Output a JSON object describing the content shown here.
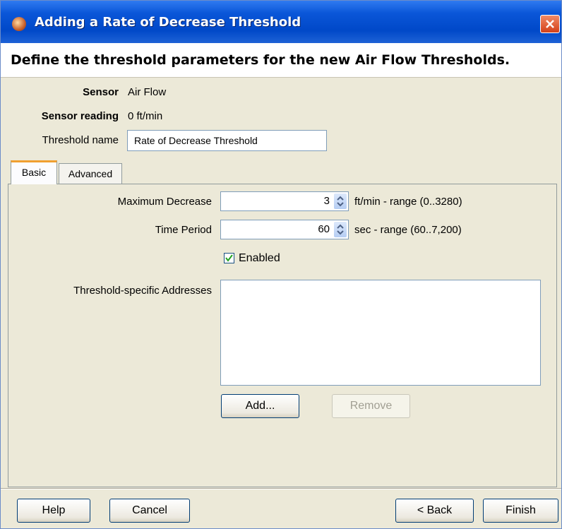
{
  "window": {
    "title": "Adding a Rate of Decrease Threshold",
    "title_color": "#0a56d8",
    "close_color": "#d44018"
  },
  "header": {
    "text": "Define the threshold parameters for the new Air Flow Thresholds."
  },
  "info": {
    "sensor_label": "Sensor",
    "sensor_value": "Air Flow",
    "reading_label": "Sensor reading",
    "reading_value": "0 ft/min",
    "name_label": "Threshold name",
    "name_value": "Rate of Decrease Threshold"
  },
  "tabs": [
    {
      "label": "Basic",
      "active": true
    },
    {
      "label": "Advanced",
      "active": false
    }
  ],
  "basic": {
    "max_decrease_label": "Maximum Decrease",
    "max_decrease_value": "3",
    "max_decrease_unit": "ft/min - range (0..3280)",
    "time_period_label": "Time Period",
    "time_period_value": "60",
    "time_period_unit": "sec - range (60..7,200)",
    "enabled_label": "Enabled",
    "enabled_checked": true,
    "addresses_label": "Threshold-specific Addresses",
    "addresses": [],
    "add_label": "Add...",
    "remove_label": "Remove"
  },
  "footer": {
    "help_label": "Help",
    "cancel_label": "Cancel",
    "back_label": "< Back",
    "finish_label": "Finish"
  }
}
